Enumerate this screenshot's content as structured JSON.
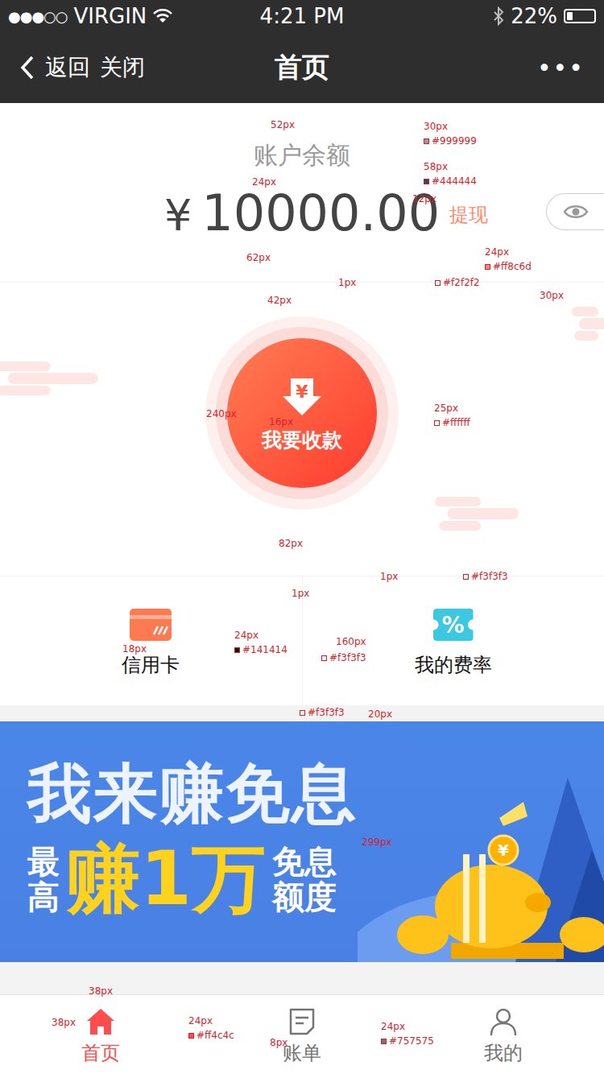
{
  "statusBar": {
    "signal": "●●●○○",
    "carrier": "VIRGIN",
    "time": "4:21 PM",
    "battery": "22%",
    "batteryLevel": 0.22
  },
  "navBar": {
    "back": "返回",
    "close": "关闭",
    "title": "首页",
    "more": "•••"
  },
  "balance": {
    "label": "账户余额",
    "currency": "¥",
    "amount": "10000.00",
    "withdraw": "提现"
  },
  "collect": {
    "iconSymbol": "¥",
    "label": "我要收款"
  },
  "shortcuts": [
    {
      "kind": "card",
      "label": "信用卡"
    },
    {
      "kind": "rate",
      "label": "我的费率",
      "iconText": "%"
    }
  ],
  "banner": {
    "title": "我来赚免息",
    "prefix": "最高",
    "highlight": "赚1万",
    "suffix": "免息额度",
    "coinSymbol": "¥"
  },
  "tabBar": [
    {
      "label": "首页",
      "selected": true
    },
    {
      "label": "账单",
      "selected": false
    },
    {
      "label": "我的",
      "selected": false
    }
  ],
  "annotations": [
    {
      "text": "52px"
    },
    {
      "text": "30px"
    },
    {
      "text": "#999999"
    },
    {
      "text": "24px"
    },
    {
      "text": "58px"
    },
    {
      "text": "#444444"
    },
    {
      "text": "12px"
    },
    {
      "text": "24px"
    },
    {
      "text": "#ff8c6d"
    },
    {
      "text": "62px"
    },
    {
      "text": "1px"
    },
    {
      "text": "#f2f2f2"
    },
    {
      "text": "30px"
    },
    {
      "text": "42px"
    },
    {
      "text": "240px"
    },
    {
      "text": "16px"
    },
    {
      "text": "25px"
    },
    {
      "text": "#ffffff"
    },
    {
      "text": "82px"
    },
    {
      "text": "1px"
    },
    {
      "text": "#f3f3f3"
    },
    {
      "text": "1px"
    },
    {
      "text": "160px"
    },
    {
      "text": "24px"
    },
    {
      "text": "18px"
    },
    {
      "text": "#141414"
    },
    {
      "text": "#f3f3f3"
    },
    {
      "text": "#f3f3f3"
    },
    {
      "text": "20px"
    },
    {
      "text": "299px"
    },
    {
      "text": "38px"
    },
    {
      "text": "38px"
    },
    {
      "text": "24px"
    },
    {
      "text": "#ff4c4c"
    },
    {
      "text": "8px"
    },
    {
      "text": "24px"
    },
    {
      "text": "#757575"
    }
  ]
}
